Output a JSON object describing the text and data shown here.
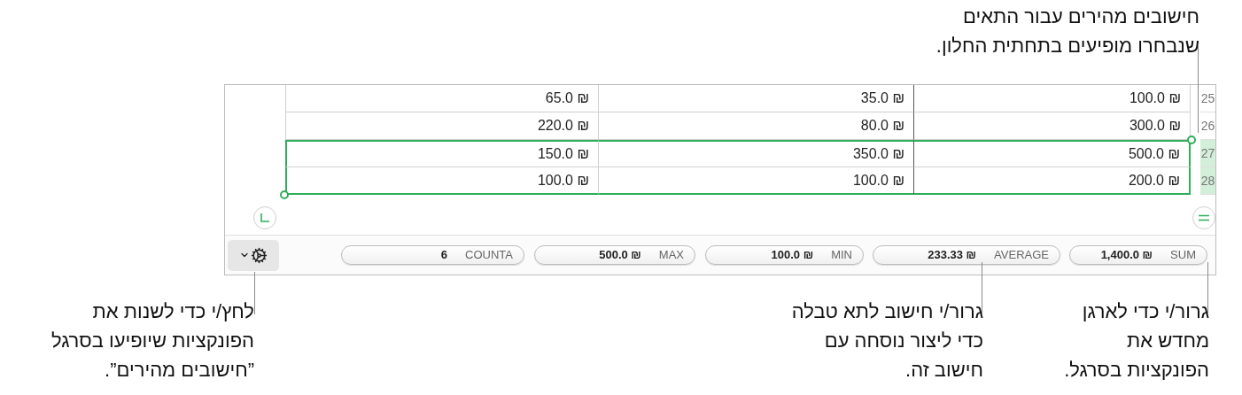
{
  "callout_top": {
    "lines": [
      "חישובים מהירים עבור התאים",
      "שנבחרו מופיעים בתחתית החלון."
    ]
  },
  "table": {
    "rows": [
      {
        "number": "25",
        "selected": false,
        "cells": [
          "100.0 ₪",
          "35.0 ₪",
          "65.0 ₪"
        ]
      },
      {
        "number": "26",
        "selected": false,
        "cells": [
          "300.0 ₪",
          "80.0 ₪",
          "220.0 ₪"
        ]
      },
      {
        "number": "27",
        "selected": true,
        "cells": [
          "500.0 ₪",
          "350.0 ₪",
          "150.0 ₪"
        ]
      },
      {
        "number": "28",
        "selected": true,
        "cells": [
          "200.0 ₪",
          "100.0 ₪",
          "100.0 ₪"
        ]
      }
    ]
  },
  "calc_bar": {
    "items": [
      {
        "label": "SUM",
        "value": "1,400.0 ₪"
      },
      {
        "label": "AVERAGE",
        "value": "233.33 ₪"
      },
      {
        "label": "MIN",
        "value": "100.0 ₪"
      },
      {
        "label": "MAX",
        "value": "500.0 ₪"
      },
      {
        "label": "COUNTA",
        "value": "6"
      }
    ]
  },
  "callouts_bottom": [
    {
      "lines": [
        "גרור/י כדי לארגן",
        "מחדש את",
        "הפונקציות בסרגל."
      ]
    },
    {
      "lines": [
        "גרור/י חישוב לתא טבלה",
        "כדי ליצור נוסחה עם",
        "חישוב זה."
      ]
    },
    {
      "lines": [
        "לחץ/י כדי לשנות את",
        "הפונקציות שיופיעו בסרגל",
        "”חישובים מהירים”."
      ]
    }
  ]
}
